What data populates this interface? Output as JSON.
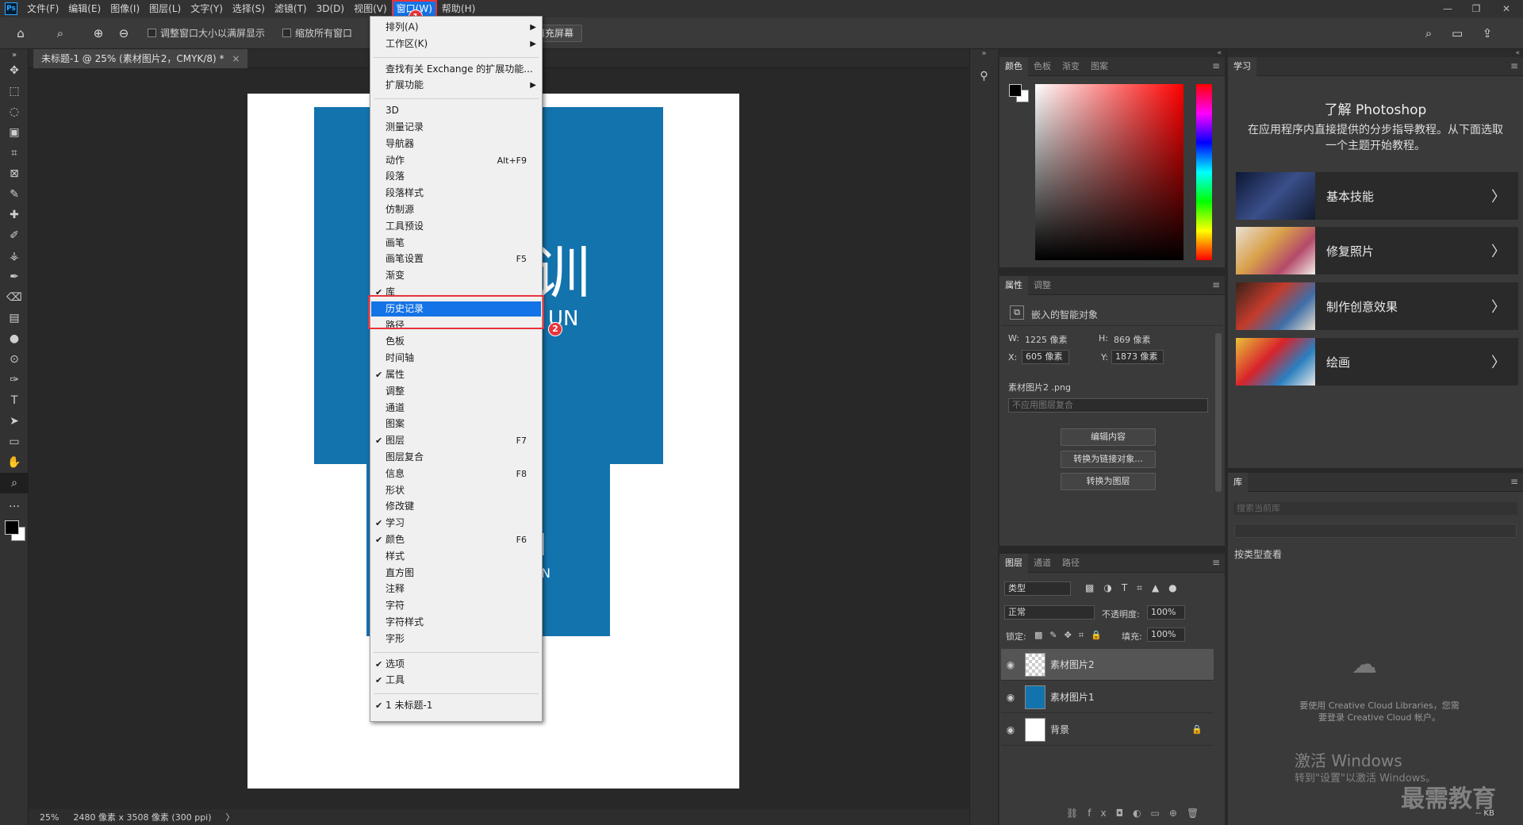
{
  "menubar": {
    "logo": "Ps",
    "items": [
      "文件(F)",
      "编辑(E)",
      "图像(I)",
      "图层(L)",
      "文字(Y)",
      "选择(S)",
      "滤镜(T)",
      "3D(D)",
      "视图(V)",
      "窗口(W)",
      "帮助(H)"
    ],
    "active_index": 9,
    "window_controls": [
      "—",
      "❐",
      "✕"
    ]
  },
  "options": {
    "home_icon": "⌂",
    "zoom_icon": "⌕",
    "zoom_in": "⊕",
    "zoom_out": "⊖",
    "resize_windows": "调整窗口大小以满屏显示",
    "zoom_all": "缩放所有窗口",
    "fill_screen": "填充屏幕",
    "search_icon": "⌕",
    "workspace_icon": "▭",
    "share_icon": "⇪"
  },
  "toolbar_collapse": "»",
  "tools": [
    "✥",
    "⬚",
    "◌",
    "▣",
    "⌗",
    "⊠",
    "✎",
    "✚",
    "✐",
    "⚶",
    "✒",
    "⌫",
    "▤",
    "●",
    "⊙",
    "✑",
    "T",
    "➤",
    "▭",
    "✋",
    "⌕",
    "…"
  ],
  "fg_bg_colors": {
    "fg": "#000000",
    "bg": "#ffffff"
  },
  "document": {
    "tab_title": "未标题-1 @ 25% (素材图片2，CMYK/8) *",
    "tab_close": "×",
    "canvas_text_1": "训",
    "canvas_text_2": "UN",
    "canvas_text_3": "Ⅰ",
    "canvas_text_4": "N"
  },
  "status": {
    "zoom": "25%",
    "doc_info": "2480 像素 x 3508 像素 (300 ppi)",
    "arrow": "〉"
  },
  "window_menu": {
    "items": [
      {
        "label": "排列(A)",
        "arrow": "▶"
      },
      {
        "label": "工作区(K)",
        "arrow": "▶"
      },
      {
        "label": "查找有关 Exchange 的扩展功能..."
      },
      {
        "label": "扩展功能",
        "arrow": "▶"
      },
      {
        "label": "3D"
      },
      {
        "label": "测量记录"
      },
      {
        "label": "导航器"
      },
      {
        "label": "动作",
        "shortcut": "Alt+F9"
      },
      {
        "label": "段落"
      },
      {
        "label": "段落样式"
      },
      {
        "label": "仿制源"
      },
      {
        "label": "工具预设"
      },
      {
        "label": "画笔"
      },
      {
        "label": "画笔设置",
        "shortcut": "F5"
      },
      {
        "label": "渐变"
      },
      {
        "label": "库",
        "check": "✔"
      },
      {
        "label": "历史记录",
        "highlight": true
      },
      {
        "label": "路径"
      },
      {
        "label": "色板"
      },
      {
        "label": "时间轴"
      },
      {
        "label": "属性",
        "check": "✔"
      },
      {
        "label": "调整"
      },
      {
        "label": "通道"
      },
      {
        "label": "图案"
      },
      {
        "label": "图层",
        "check": "✔",
        "shortcut": "F7"
      },
      {
        "label": "图层复合"
      },
      {
        "label": "信息",
        "shortcut": "F8"
      },
      {
        "label": "形状"
      },
      {
        "label": "修改键"
      },
      {
        "label": "学习",
        "check": "✔"
      },
      {
        "label": "颜色",
        "check": "✔",
        "shortcut": "F6"
      },
      {
        "label": "样式"
      },
      {
        "label": "直方图"
      },
      {
        "label": "注释"
      },
      {
        "label": "字符"
      },
      {
        "label": "字符样式"
      },
      {
        "label": "字形"
      },
      {
        "label": "选项",
        "check": "✔"
      },
      {
        "label": "工具",
        "check": "✔"
      },
      {
        "label": "1 未标题-1",
        "check": "✔"
      }
    ],
    "badge_1": "1",
    "badge_2": "2"
  },
  "strip_icon": "⚲",
  "panel_collapse": "«",
  "color_panel": {
    "tabs": [
      "颜色",
      "色板",
      "渐变",
      "图案"
    ],
    "menu": "≡"
  },
  "properties_panel": {
    "tabs": [
      "属性",
      "调整"
    ],
    "menu": "≡",
    "type_icon": "⧉",
    "type": "嵌入的智能对象",
    "w_label": "W:",
    "w": "1225 像素",
    "h_label": "H:",
    "h": "869 像素",
    "x_label": "X:",
    "x": "605 像素",
    "y_label": "Y:",
    "y": "1873 像素",
    "file": "素材图片2 .png",
    "comp_placeholder": "不应用图层复合",
    "btn_edit": "编辑内容",
    "btn_link": "转换为链接对象...",
    "btn_layer": "转换为图层"
  },
  "layers_panel": {
    "tabs": [
      "图层",
      "通道",
      "路径"
    ],
    "menu": "≡",
    "filter": "类型",
    "filter_icons": [
      "▩",
      "◑",
      "T",
      "⌗",
      "▲",
      "●"
    ],
    "blend": "正常",
    "opacity_label": "不透明度:",
    "opacity": "100%",
    "lock_label": "锁定:",
    "lock_icons": [
      "▩",
      "✎",
      "✥",
      "⌗",
      "🔒"
    ],
    "fill_label": "填充:",
    "fill": "100%",
    "layers": [
      {
        "name": "素材图片2",
        "eye": "◉"
      },
      {
        "name": "素材图片1",
        "eye": "◉"
      },
      {
        "name": "背景",
        "eye": "◉",
        "lock": "🔒"
      }
    ],
    "footer_icons": [
      "⛓",
      "fx",
      "◘",
      "◐",
      "▭",
      "⊕",
      "🗑"
    ]
  },
  "learn_panel": {
    "tab": "学习",
    "menu": "≡",
    "title": "了解 Photoshop",
    "desc": "在应用程序内直接提供的分步指导教程。从下面选取一个主题开始教程。",
    "cards": [
      {
        "title": "基本技能",
        "chevron": "〉"
      },
      {
        "title": "修复照片",
        "chevron": "〉"
      },
      {
        "title": "制作创意效果",
        "chevron": "〉"
      },
      {
        "title": "绘画",
        "chevron": "〉"
      }
    ]
  },
  "library_panel": {
    "tab": "库",
    "menu": "≡",
    "search_placeholder": "搜索当前库",
    "view_label": "按类型查看",
    "cloud_icon": "☁",
    "cloud_msg": "要使用 Creative Cloud Libraries，您需要登录 Creative Cloud 帐户。",
    "size": "-- KB"
  },
  "watermark": {
    "line1": "激活 Windows",
    "line2": "转到\"设置\"以激活 Windows。",
    "brand": "最需教育"
  }
}
